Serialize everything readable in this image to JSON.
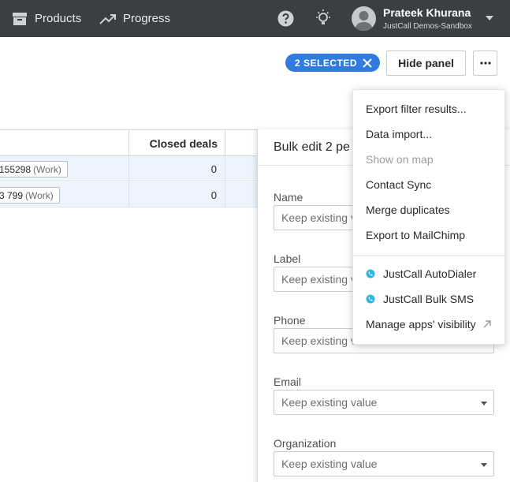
{
  "nav": {
    "products_label": "Products",
    "progress_label": "Progress",
    "user_name": "Prateek Khurana",
    "user_company": "JustCall Demos-Sandbox"
  },
  "toolbar": {
    "selected_label": "2 SELECTED",
    "hide_panel_label": "Hide panel",
    "more_label": "···"
  },
  "table": {
    "column_closed_deals": "Closed deals",
    "rows": [
      {
        "phone": "155298",
        "phone_type": "(Work)",
        "closed_deals": "0"
      },
      {
        "phone": "3 799",
        "phone_type": "(Work)",
        "closed_deals": "0"
      }
    ]
  },
  "bulk_edit": {
    "title": "Bulk edit 2 pe",
    "fields": [
      {
        "label": "Name",
        "value": "Keep existing va"
      },
      {
        "label": "Label",
        "value": "Keep existing va"
      },
      {
        "label": "Phone",
        "value": "Keep existing va"
      },
      {
        "label": "Email",
        "value": "Keep existing value"
      },
      {
        "label": "Organization",
        "value": "Keep existing value"
      }
    ]
  },
  "menu": {
    "items": [
      {
        "label": "Export filter results..."
      },
      {
        "label": "Data import..."
      },
      {
        "label": "Show on map"
      },
      {
        "label": "Contact Sync"
      },
      {
        "label": "Merge duplicates"
      },
      {
        "label": "Export to MailChimp"
      },
      {
        "label": "JustCall AutoDialer"
      },
      {
        "label": "JustCall Bulk SMS"
      },
      {
        "label": "Manage apps' visibility"
      }
    ]
  },
  "colors": {
    "nav_bg": "#3c3f42",
    "accent": "#317ae2",
    "selected_row_bg": "#eef4fd",
    "app_icon": "#2fb5e8"
  }
}
